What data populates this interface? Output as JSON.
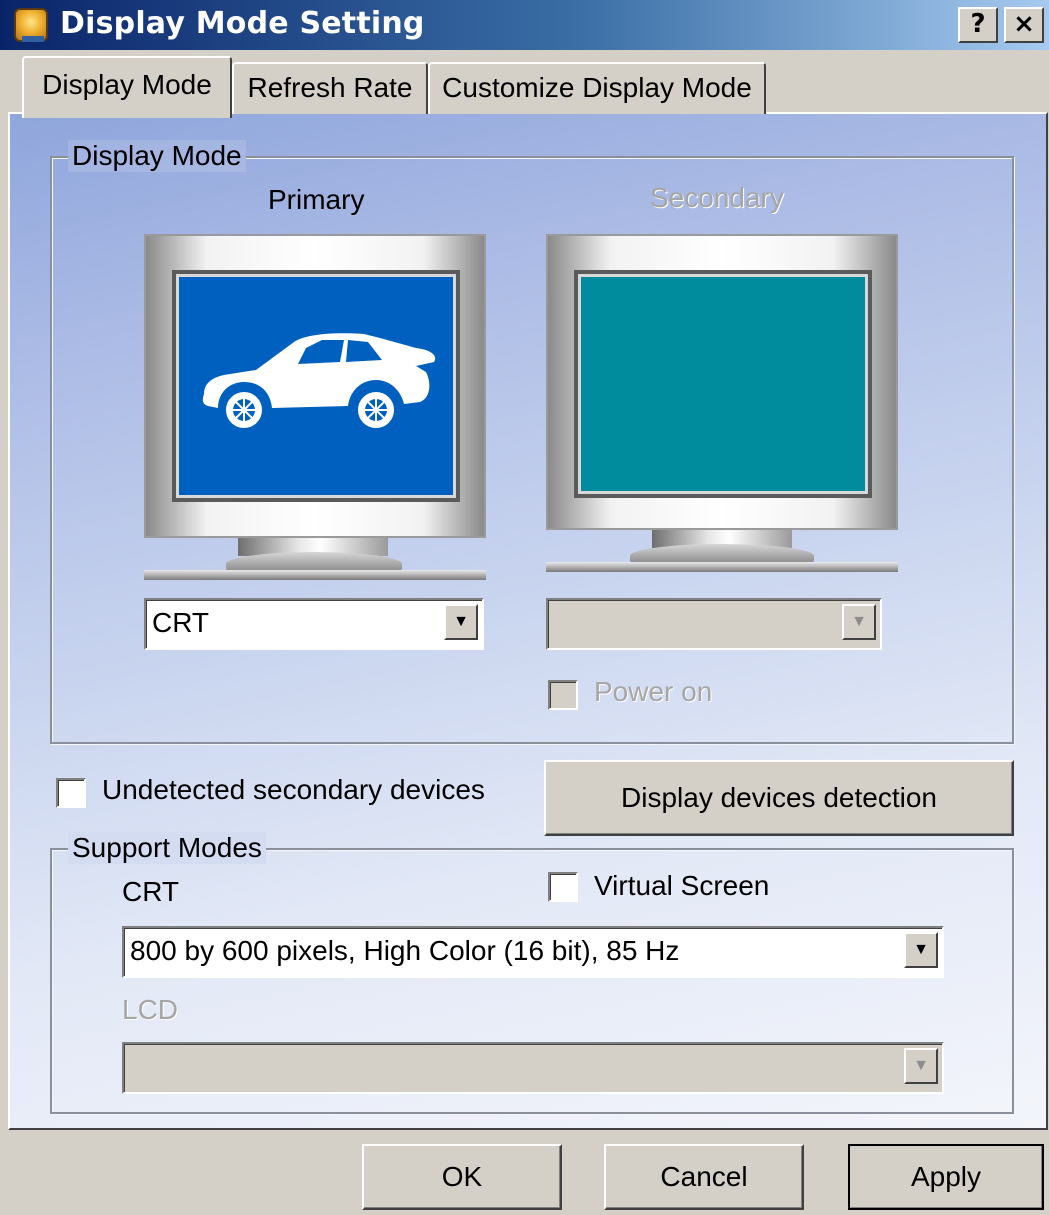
{
  "window": {
    "title": "Display Mode Setting",
    "help_label": "?",
    "close_label": "×"
  },
  "tabs": [
    {
      "label": "Display Mode",
      "active": true
    },
    {
      "label": "Refresh Rate",
      "active": false
    },
    {
      "label": "Customize Display Mode",
      "active": false
    }
  ],
  "display_mode_group": {
    "legend": "Display Mode",
    "primary": {
      "heading": "Primary",
      "screen_color": "#0060c0",
      "icon": "car-icon",
      "device_select": "CRT"
    },
    "secondary": {
      "heading": "Secondary",
      "screen_color": "#008c9c",
      "device_select": "",
      "power_on_label": "Power on",
      "power_on_checked": false,
      "enabled": false
    }
  },
  "undetected": {
    "label": "Undetected secondary devices",
    "checked": false
  },
  "detection_button": "Display devices detection",
  "support_modes": {
    "legend": "Support Modes",
    "crt_label": "CRT",
    "virtual_screen_label": "Virtual Screen",
    "virtual_screen_checked": false,
    "crt_mode": "800 by 600 pixels, High Color (16 bit), 85 Hz",
    "lcd_label": "LCD",
    "lcd_mode": ""
  },
  "buttons": {
    "ok": "OK",
    "cancel": "Cancel",
    "apply": "Apply"
  },
  "colors": {
    "title_start": "#0a246a",
    "title_end": "#a6caf0",
    "face": "#d4d0c8"
  }
}
